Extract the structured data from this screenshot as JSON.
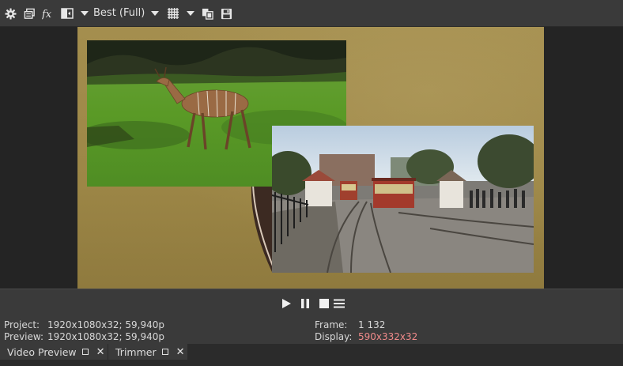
{
  "toolbar": {
    "quality_label": "Best (Full)",
    "icons": [
      "gear-icon",
      "preview-settings-icon",
      "fx-icon",
      "split-screen-icon",
      "grid-overlay-icon",
      "copy-snapshot-icon",
      "save-snapshot-icon"
    ]
  },
  "transport": {
    "icons": [
      "play-icon",
      "pause-icon",
      "stop-icon",
      "menu-icon"
    ]
  },
  "info": {
    "project_label": "Project:",
    "project_value": "1920x1080x32; 59,940p",
    "preview_label": "Preview:",
    "preview_value": "1920x1080x32; 59,940p",
    "frame_label": "Frame:",
    "frame_value": "1 132",
    "display_label": "Display:",
    "display_value": "590x332x32"
  },
  "tabs": [
    {
      "label": "Video Preview"
    },
    {
      "label": "Trimmer"
    }
  ],
  "colors": {
    "display_value": "#f08a8a",
    "background": "#2b2b2b",
    "panel": "#3a3a3a"
  }
}
